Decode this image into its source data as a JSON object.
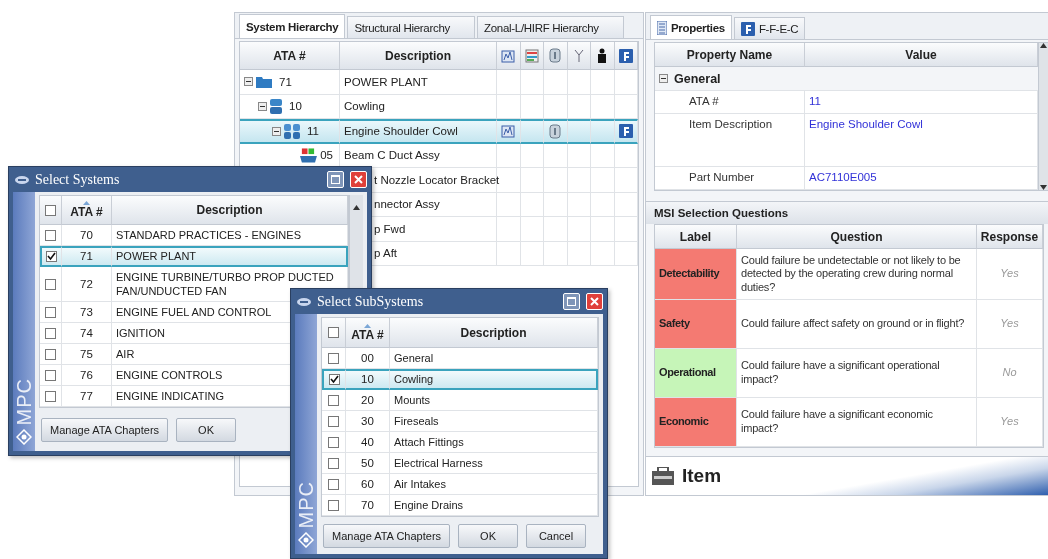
{
  "hierarchy": {
    "tabs": [
      {
        "label": "System Hierarchy",
        "selected": true
      },
      {
        "label": "Structural Hierarchy",
        "selected": false
      },
      {
        "label": "Zonal-L/HIRF Hierarchy",
        "selected": false
      }
    ],
    "columns": [
      "ATA #",
      "Description"
    ],
    "rows": [
      {
        "kind": "node",
        "ata": "71",
        "description": "POWER PLANT",
        "expanded": true,
        "selected": false,
        "column_icons": [
          false,
          false,
          false,
          false,
          false,
          false
        ],
        "children": [
          {
            "kind": "node",
            "ata": "10",
            "description": "Cowling",
            "expanded": true,
            "selected": false,
            "column_icons": [
              false,
              false,
              false,
              false,
              false,
              false
            ],
            "children": [
              {
                "kind": "node",
                "ata": "11",
                "description": "Engine Shoulder Cowl",
                "expanded": true,
                "selected": true,
                "column_icons": [
                  true,
                  false,
                  true,
                  false,
                  false,
                  true
                ],
                "children": [
                  {
                    "kind": "leaf",
                    "ata": "05",
                    "description": "Beam C Duct Assy",
                    "selected": false,
                    "column_icons": [
                      false,
                      false,
                      false,
                      false,
                      false,
                      false
                    ]
                  },
                  {
                    "kind": "partial",
                    "description": "t Nozzle Locator Bracket",
                    "selected": false,
                    "column_icons": [
                      false,
                      false,
                      false,
                      false,
                      false,
                      false
                    ]
                  },
                  {
                    "kind": "partial",
                    "description": "nnector Assy",
                    "selected": false,
                    "column_icons": [
                      false,
                      false,
                      false,
                      false,
                      false,
                      false
                    ]
                  },
                  {
                    "kind": "partial",
                    "description": "p Fwd",
                    "selected": false,
                    "column_icons": [
                      false,
                      false,
                      false,
                      false,
                      false,
                      false
                    ]
                  },
                  {
                    "kind": "partial",
                    "description": "p Aft",
                    "selected": false,
                    "column_icons": [
                      false,
                      false,
                      false,
                      false,
                      false,
                      false
                    ]
                  }
                ]
              }
            ]
          }
        ]
      }
    ]
  },
  "properties": {
    "tabs": [
      {
        "label": "Properties",
        "selected": true
      },
      {
        "label": "F-F-E-C",
        "selected": false
      }
    ],
    "columns": [
      "Property Name",
      "Value"
    ],
    "group": {
      "label": "General",
      "expanded": true
    },
    "rows": [
      {
        "name": "ATA #",
        "value": "11",
        "tall": false
      },
      {
        "name": "Item Description",
        "value": "Engine Shoulder Cowl",
        "tall": true
      },
      {
        "name": "Part Number",
        "value": "AC7110E005",
        "tall": false
      }
    ]
  },
  "msi": {
    "title": "MSI Selection Questions",
    "columns": [
      "Label",
      "Question",
      "Response"
    ],
    "rows": [
      {
        "label": "Detectability",
        "color": "#f47a72",
        "question": "Could failure be undetectable or not likely to be detected by the operating crew during normal duties?",
        "response": "Yes"
      },
      {
        "label": "Safety",
        "color": "#f47a72",
        "question": "Could failure affect safety on ground or in flight?",
        "response": "Yes"
      },
      {
        "label": "Operational",
        "color": "#c6f5b8",
        "question": "Could failure have a significant operational impact?",
        "response": "No"
      },
      {
        "label": "Economic",
        "color": "#f47a72",
        "question": "Could failure have a significant economic impact?",
        "response": "Yes"
      }
    ]
  },
  "item_bar": {
    "title": "Item"
  },
  "dialogs": [
    {
      "title": "Select Systems",
      "brand": "MPC",
      "columns": [
        "ATA #",
        "Description"
      ],
      "all_checked": false,
      "rows": [
        {
          "ata": "70",
          "description": "STANDARD PRACTICES - ENGINES",
          "checked": false,
          "selected": false
        },
        {
          "ata": "71",
          "description": "POWER PLANT",
          "checked": true,
          "selected": true
        },
        {
          "ata": "72",
          "description": "ENGINE TURBINE/TURBO PROP DUCTED FAN/UNDUCTED FAN",
          "checked": false,
          "selected": false
        },
        {
          "ata": "73",
          "description": "ENGINE FUEL AND CONTROL",
          "checked": false,
          "selected": false
        },
        {
          "ata": "74",
          "description": "IGNITION",
          "checked": false,
          "selected": false
        },
        {
          "ata": "75",
          "description": "AIR",
          "checked": false,
          "selected": false
        },
        {
          "ata": "76",
          "description": "ENGINE CONTROLS",
          "checked": false,
          "selected": false
        },
        {
          "ata": "77",
          "description": "ENGINE INDICATING",
          "checked": false,
          "selected": false
        }
      ],
      "buttons": [
        "Manage ATA Chapters",
        "OK"
      ]
    },
    {
      "title": "Select SubSystems",
      "brand": "MPC",
      "columns": [
        "ATA #",
        "Description"
      ],
      "all_checked": false,
      "rows": [
        {
          "ata": "00",
          "description": "General",
          "checked": false,
          "selected": false
        },
        {
          "ata": "10",
          "description": "Cowling",
          "checked": true,
          "selected": true
        },
        {
          "ata": "20",
          "description": "Mounts",
          "checked": false,
          "selected": false
        },
        {
          "ata": "30",
          "description": "Fireseals",
          "checked": false,
          "selected": false
        },
        {
          "ata": "40",
          "description": "Attach Fittings",
          "checked": false,
          "selected": false
        },
        {
          "ata": "50",
          "description": "Electrical Harness",
          "checked": false,
          "selected": false
        },
        {
          "ata": "60",
          "description": "Air Intakes",
          "checked": false,
          "selected": false
        },
        {
          "ata": "70",
          "description": "Engine Drains",
          "checked": false,
          "selected": false
        }
      ],
      "buttons": [
        "Manage ATA Chapters",
        "OK",
        "Cancel"
      ]
    }
  ]
}
